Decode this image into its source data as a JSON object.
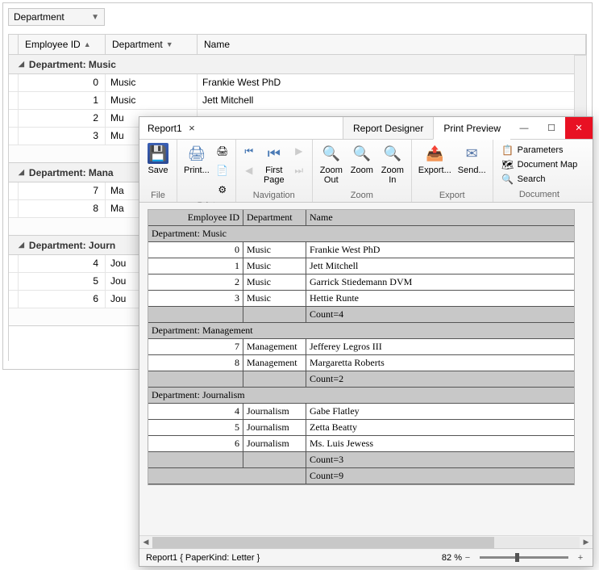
{
  "bg": {
    "dropdown": "Department",
    "columns": {
      "c1": "Employee ID",
      "c2": "Department",
      "c3": "Name"
    },
    "groups": [
      {
        "label": "Department: Music",
        "rows": [
          {
            "id": "0",
            "dept": "Music",
            "name": "Frankie West PhD"
          },
          {
            "id": "1",
            "dept": "Music",
            "name": "Jett Mitchell"
          },
          {
            "id": "2",
            "dept": "Mu",
            "name": ""
          },
          {
            "id": "3",
            "dept": "Mu",
            "name": ""
          }
        ]
      },
      {
        "label": "Department: Mana",
        "rows": [
          {
            "id": "7",
            "dept": "Ma",
            "name": ""
          },
          {
            "id": "8",
            "dept": "Ma",
            "name": ""
          }
        ]
      },
      {
        "label": "Department: Journ",
        "rows": [
          {
            "id": "4",
            "dept": "Jou",
            "name": ""
          },
          {
            "id": "5",
            "dept": "Jou",
            "name": ""
          },
          {
            "id": "6",
            "dept": "Jou",
            "name": ""
          }
        ]
      }
    ]
  },
  "report": {
    "title": "Report1",
    "tabs": {
      "designer": "Report Designer",
      "preview": "Print Preview"
    },
    "ribbon": {
      "file": {
        "label": "File",
        "save": "Save"
      },
      "print": {
        "label": "Print",
        "print": "Print..."
      },
      "nav": {
        "label": "Navigation",
        "first": "First\nPage"
      },
      "zoom": {
        "label": "Zoom",
        "out": "Zoom\nOut",
        "z": "Zoom",
        "in": "Zoom\nIn"
      },
      "export": {
        "label": "Export",
        "export": "Export...",
        "send": "Send..."
      },
      "doc": {
        "label": "Document",
        "params": "Parameters",
        "map": "Document Map",
        "search": "Search"
      }
    },
    "preview": {
      "header": {
        "c1": "Employee ID",
        "c2": "Department",
        "c3": "Name"
      },
      "groups": [
        {
          "label": "Department:  Music",
          "rows": [
            {
              "id": "0",
              "dept": "Music",
              "name": "Frankie West PhD"
            },
            {
              "id": "1",
              "dept": "Music",
              "name": "Jett Mitchell"
            },
            {
              "id": "2",
              "dept": "Music",
              "name": "Garrick Stiedemann DVM"
            },
            {
              "id": "3",
              "dept": "Music",
              "name": "Hettie Runte"
            }
          ],
          "count": "Count=4"
        },
        {
          "label": "Department:  Management",
          "rows": [
            {
              "id": "7",
              "dept": "Management",
              "name": "Jefferey Legros III"
            },
            {
              "id": "8",
              "dept": "Management",
              "name": "Margaretta Roberts"
            }
          ],
          "count": "Count=2"
        },
        {
          "label": "Department:  Journalism",
          "rows": [
            {
              "id": "4",
              "dept": "Journalism",
              "name": "Gabe Flatley"
            },
            {
              "id": "5",
              "dept": "Journalism",
              "name": "Zetta Beatty"
            },
            {
              "id": "6",
              "dept": "Journalism",
              "name": "Ms. Luis Jewess"
            }
          ],
          "count": "Count=3"
        }
      ],
      "total": "Count=9"
    },
    "status": {
      "text": "Report1 { PaperKind: Letter }",
      "zoom": "82 %"
    }
  }
}
